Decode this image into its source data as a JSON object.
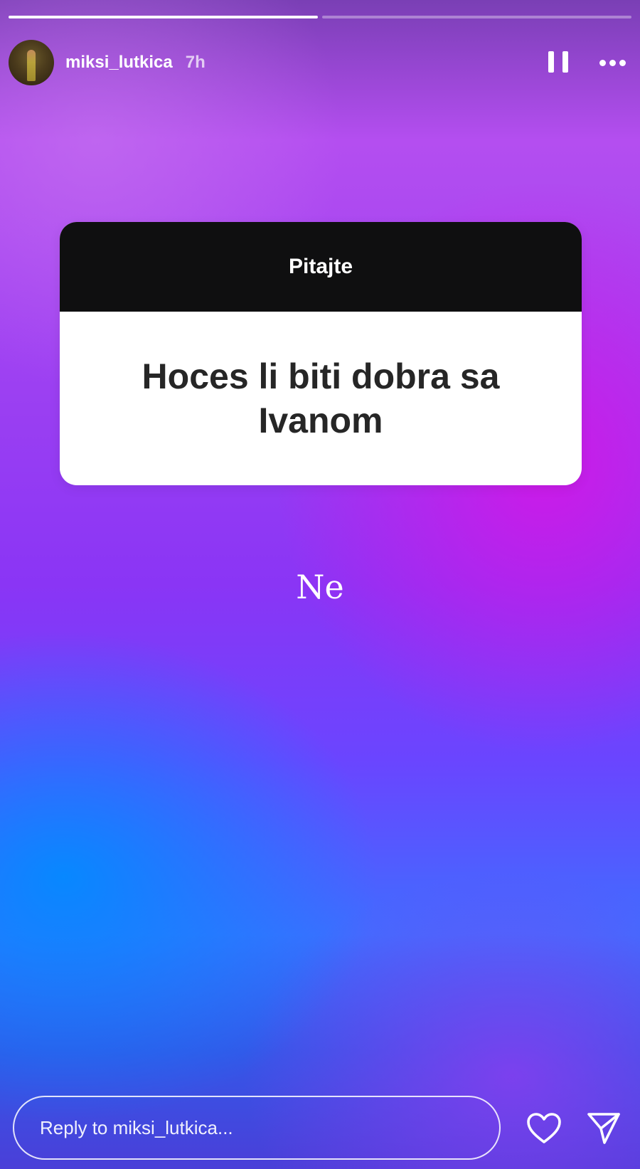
{
  "story": {
    "segments_total": 2,
    "segments_viewed": 1
  },
  "header": {
    "username": "miksi_lutkica",
    "time": "7h",
    "pause_icon": "pause-icon",
    "more_icon": "more-horizontal-icon"
  },
  "question_sticker": {
    "title": "Pitajte",
    "question": "Hoces li biti dobra sa Ivanom"
  },
  "answer_text": "Ne",
  "footer": {
    "reply_placeholder": "Reply to miksi_lutkica...",
    "like_icon": "heart-icon",
    "share_icon": "send-icon"
  },
  "colors": {
    "card_header": "#0f0f10",
    "card_body": "#ffffff",
    "question_text": "#262626",
    "gradient_top": "#b44ef0",
    "gradient_mid": "#8a35f5",
    "gradient_bottom": "#3f6dff"
  }
}
